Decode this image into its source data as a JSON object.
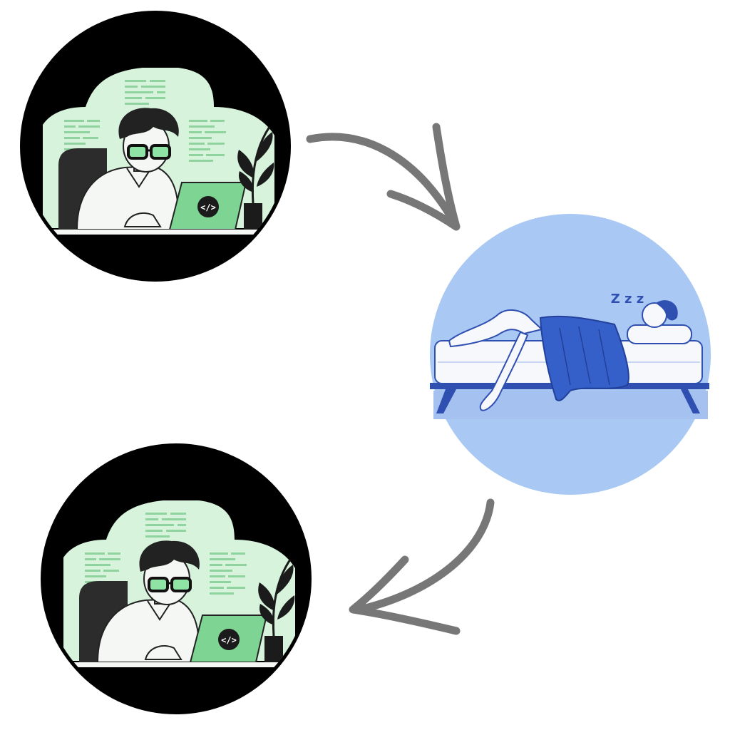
{
  "cycle": {
    "steps": [
      {
        "id": "coding",
        "laptop_glyph": "</>",
        "icon": "developer-coding-icon"
      },
      {
        "id": "sleeping",
        "sleep_glyph": "Z z z",
        "icon": "person-sleeping-icon"
      },
      {
        "id": "coding-again",
        "laptop_glyph": "</>",
        "icon": "developer-coding-icon"
      }
    ],
    "arrows": [
      {
        "from": "coding",
        "to": "sleeping",
        "icon": "curved-arrow-icon"
      },
      {
        "from": "sleeping",
        "to": "coding-again",
        "icon": "curved-arrow-icon"
      }
    ]
  },
  "colors": {
    "background": "#ffffff",
    "coding_circle": "#000000",
    "coding_bg": "#d7f3dc",
    "laptop": "#7ed492",
    "sleep_circle": "#a9c8f3",
    "blanket": "#3560c9",
    "bed": "#f7f8fc",
    "arrow": "#777777"
  }
}
